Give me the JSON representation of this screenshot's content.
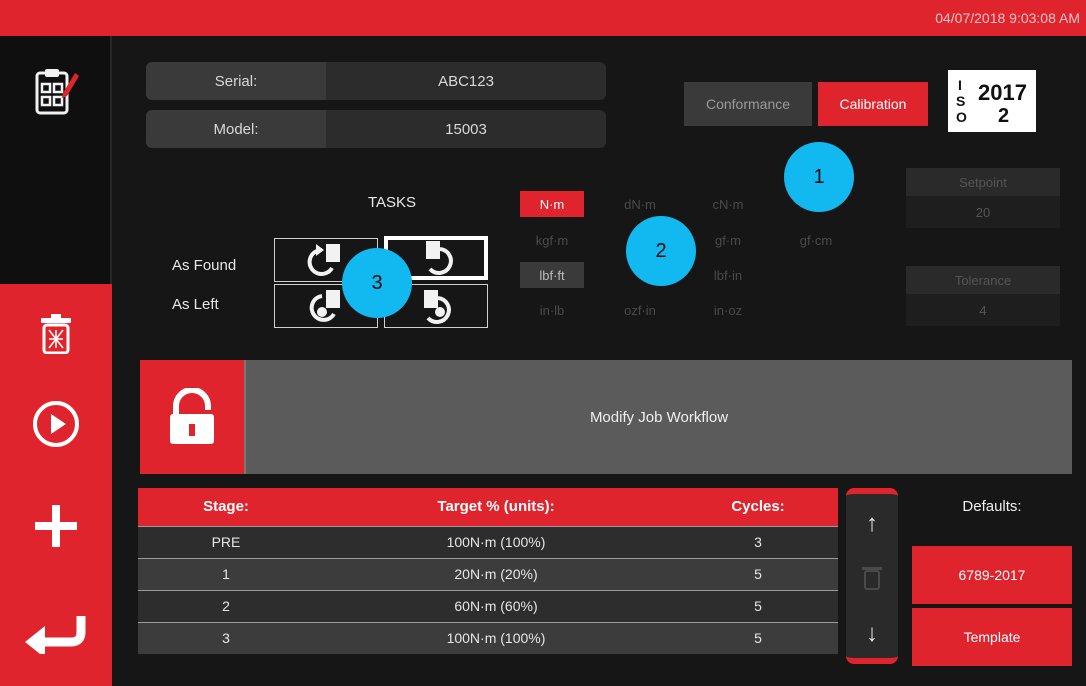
{
  "header": {
    "datetime": "04/07/2018 9:03:08 AM"
  },
  "device": {
    "serial_label": "Serial:",
    "serial_value": "ABC123",
    "model_label": "Model:",
    "model_value": "15003"
  },
  "mode_toggle": {
    "conformance_label": "Conformance",
    "calibration_label": "Calibration",
    "selected": "Calibration"
  },
  "iso_logo": {
    "letters": "ISO",
    "year": "2017",
    "part": "2"
  },
  "callouts": [
    "1",
    "2",
    "3"
  ],
  "tasks": {
    "title": "TASKS",
    "as_found_label": "As Found",
    "as_left_label": "As Left"
  },
  "units": {
    "row1": [
      "N·m",
      "dN·m",
      "cN·m"
    ],
    "row2": [
      "kgf·m",
      "",
      "gf·m",
      "gf·cm"
    ],
    "row3": [
      "lbf·ft",
      "",
      "lbf·in"
    ],
    "row4": [
      "in·lb",
      "ozf·in",
      "in·oz"
    ],
    "selected": [
      "N·m",
      "lbf·ft"
    ]
  },
  "setpoint": {
    "label": "Setpoint",
    "value": "20"
  },
  "tolerance": {
    "label": "Tolerance",
    "value": "4"
  },
  "workflow": {
    "label": "Modify Job Workflow"
  },
  "stages_table": {
    "headers": [
      "Stage:",
      "Target % (units):",
      "Cycles:"
    ],
    "rows": [
      [
        "PRE",
        "100N·m (100%)",
        "3"
      ],
      [
        "1",
        "20N·m (20%)",
        "5"
      ],
      [
        "2",
        "60N·m (60%)",
        "5"
      ],
      [
        "3",
        "100N·m (100%)",
        "5"
      ]
    ]
  },
  "scroll": {
    "up": "↑",
    "down": "↓"
  },
  "defaults": {
    "title": "Defaults:",
    "standard_button": "6789-2017",
    "template_button": "Template"
  },
  "colors": {
    "accent": "#e0242e",
    "callout": "#12b8f0",
    "panel": "#2c2c2c"
  }
}
